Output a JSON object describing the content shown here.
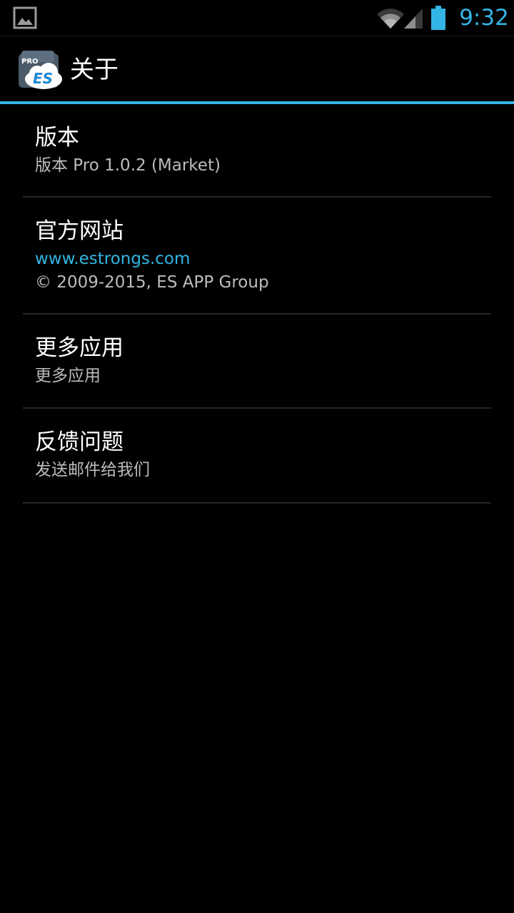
{
  "status_bar": {
    "time": "9:32",
    "accent_color": "#33b5e5",
    "icons": [
      "gallery-icon",
      "wifi-icon",
      "signal-icon",
      "battery-icon"
    ]
  },
  "action_bar": {
    "title": "关于",
    "app_icon_badge": "PRO",
    "app_icon_text": "ES"
  },
  "items": [
    {
      "title": "版本",
      "subtitle": "版本 Pro 1.0.2 (Market)"
    },
    {
      "title": "官方网站",
      "link": "www.estrongs.com",
      "subtitle": "© 2009-2015, ES APP Group"
    },
    {
      "title": "更多应用",
      "subtitle": "更多应用"
    },
    {
      "title": "反馈问题",
      "subtitle": "发送邮件给我们"
    }
  ]
}
